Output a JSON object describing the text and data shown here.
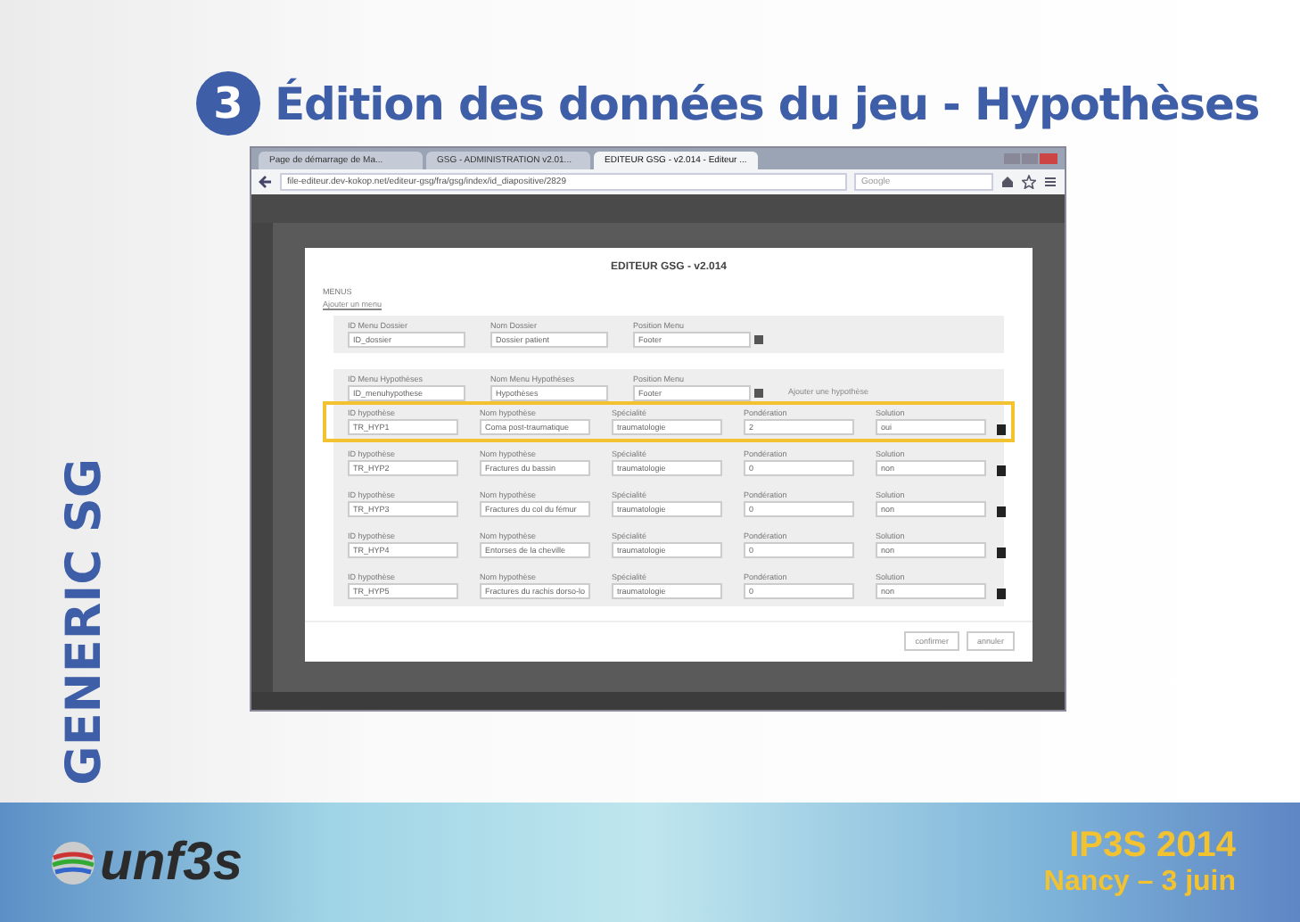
{
  "title": {
    "number": "3",
    "text": "Édition des données du jeu - Hypothèses"
  },
  "side_label": "GENERIC SG",
  "browser": {
    "tabs": [
      {
        "label": "Page de démarrage de Ma...",
        "selected": false
      },
      {
        "label": "GSG - ADMINISTRATION v2.01...",
        "selected": false
      },
      {
        "label": "EDITEUR GSG - v2.014 - Editeur ...",
        "selected": true
      }
    ],
    "url": "file-editeur.dev-kokop.net/editeur-gsg/fra/gsg/index/id_diapositive/2829",
    "search_placeholder": "Google"
  },
  "modal": {
    "title": "EDITEUR GSG - v2.014",
    "section": "MENUS",
    "add_menu_link": "Ajouter un menu",
    "menu_dossier": [
      {
        "label": "ID Menu Dossier",
        "value": "ID_dossier",
        "kind": "text"
      },
      {
        "label": "Nom Dossier",
        "value": "Dossier patient",
        "kind": "text"
      },
      {
        "label": "Position Menu",
        "value": "Footer",
        "kind": "select"
      }
    ],
    "menu_hypotheses": [
      {
        "label": "ID Menu Hypothèses",
        "value": "ID_menuhypothese",
        "kind": "text"
      },
      {
        "label": "Nom Menu Hypothèses",
        "value": "Hypothèses",
        "kind": "text"
      },
      {
        "label": "Position Menu",
        "value": "Footer",
        "kind": "select"
      }
    ],
    "add_hypothesis_link": "Ajouter une hypothèse",
    "hypotheses": [
      {
        "fields": [
          {
            "label": "ID hypothèse",
            "value": "TR_HYP1"
          },
          {
            "label": "Nom hypothèse",
            "value": "Coma post-traumatique"
          },
          {
            "label": "Spécialité",
            "value": "traumatologie"
          },
          {
            "label": "Pondération",
            "value": "2"
          },
          {
            "label": "Solution",
            "value": "oui"
          }
        ],
        "highlighted": true
      },
      {
        "fields": [
          {
            "label": "ID hypothèse",
            "value": "TR_HYP2"
          },
          {
            "label": "Nom hypothèse",
            "value": "Fractures du bassin"
          },
          {
            "label": "Spécialité",
            "value": "traumatologie"
          },
          {
            "label": "Pondération",
            "value": "0"
          },
          {
            "label": "Solution",
            "value": "non"
          }
        ],
        "highlighted": false
      },
      {
        "fields": [
          {
            "label": "ID hypothèse",
            "value": "TR_HYP3"
          },
          {
            "label": "Nom hypothèse",
            "value": "Fractures du col du fémur"
          },
          {
            "label": "Spécialité",
            "value": "traumatologie"
          },
          {
            "label": "Pondération",
            "value": "0"
          },
          {
            "label": "Solution",
            "value": "non"
          }
        ],
        "highlighted": false
      },
      {
        "fields": [
          {
            "label": "ID hypothèse",
            "value": "TR_HYP4"
          },
          {
            "label": "Nom hypothèse",
            "value": "Entorses de la cheville"
          },
          {
            "label": "Spécialité",
            "value": "traumatologie"
          },
          {
            "label": "Pondération",
            "value": "0"
          },
          {
            "label": "Solution",
            "value": "non"
          }
        ],
        "highlighted": false
      },
      {
        "fields": [
          {
            "label": "ID hypothèse",
            "value": "TR_HYP5"
          },
          {
            "label": "Nom hypothèse",
            "value": "Fractures du rachis dorso-lo"
          },
          {
            "label": "Spécialité",
            "value": "traumatologie"
          },
          {
            "label": "Pondération",
            "value": "0"
          },
          {
            "label": "Solution",
            "value": "non"
          }
        ],
        "highlighted": false
      }
    ],
    "buttons": [
      "confirmer",
      "annuler"
    ]
  },
  "footer": {
    "logo": "unf3s",
    "event": "IP3S 2014",
    "place": "Nancy – 3 juin"
  }
}
